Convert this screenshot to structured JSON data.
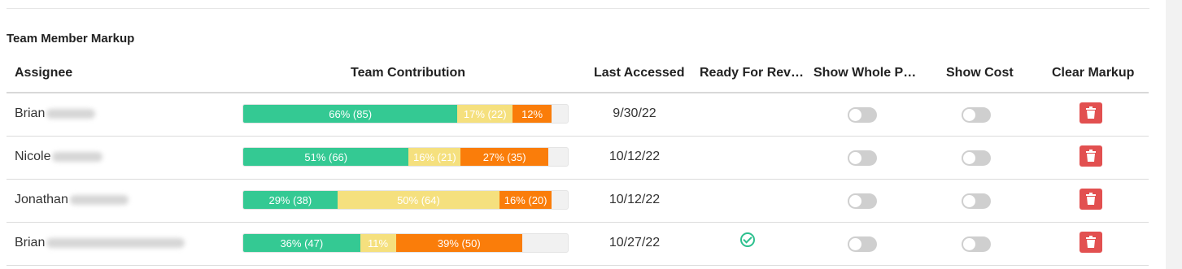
{
  "section_title": "Team Member Markup",
  "columns": {
    "assignee": "Assignee",
    "team_contribution": "Team Contribution",
    "last_accessed": "Last Accessed",
    "ready_for_review": "Ready For Rev…",
    "show_whole_p": "Show Whole P…",
    "show_cost": "Show Cost",
    "clear_markup": "Clear Markup"
  },
  "colors": {
    "green": "#34c993",
    "yellow": "#f5e07e",
    "orange": "#fa7d0a",
    "delete": "#e25050",
    "check": "#2cc08e"
  },
  "rows": [
    {
      "first_name": "Brian",
      "last_accessed": "9/30/22",
      "ready_for_review": false,
      "show_whole_project": false,
      "show_cost": false,
      "contribution": [
        {
          "color": "green",
          "percent": 66,
          "label": "66% (85)"
        },
        {
          "color": "yellow",
          "percent": 17,
          "label": "17% (22)"
        },
        {
          "color": "orange",
          "percent": 12,
          "label": "12%"
        }
      ]
    },
    {
      "first_name": "Nicole",
      "last_accessed": "10/12/22",
      "ready_for_review": false,
      "show_whole_project": false,
      "show_cost": false,
      "contribution": [
        {
          "color": "green",
          "percent": 51,
          "label": "51% (66)"
        },
        {
          "color": "yellow",
          "percent": 16,
          "label": "16% (21)"
        },
        {
          "color": "orange",
          "percent": 27,
          "label": "27% (35)"
        }
      ]
    },
    {
      "first_name": "Jonathan",
      "last_accessed": "10/12/22",
      "ready_for_review": false,
      "show_whole_project": false,
      "show_cost": false,
      "contribution": [
        {
          "color": "green",
          "percent": 29,
          "label": "29% (38)"
        },
        {
          "color": "yellow",
          "percent": 50,
          "label": "50% (64)"
        },
        {
          "color": "orange",
          "percent": 16,
          "label": "16% (20)"
        }
      ]
    },
    {
      "first_name": "Brian",
      "last_accessed": "10/27/22",
      "ready_for_review": true,
      "show_whole_project": false,
      "show_cost": false,
      "contribution": [
        {
          "color": "green",
          "percent": 36,
          "label": "36% (47)"
        },
        {
          "color": "yellow",
          "percent": 11,
          "label": "11%"
        },
        {
          "color": "orange",
          "percent": 39,
          "label": "39% (50)"
        }
      ]
    }
  ]
}
